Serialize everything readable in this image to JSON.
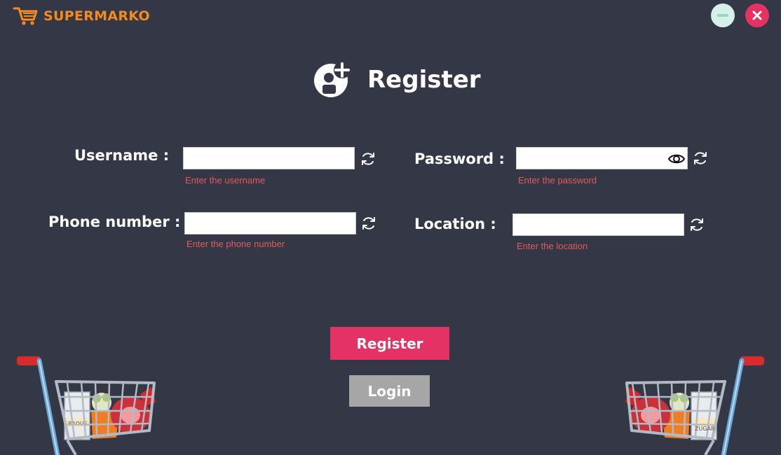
{
  "app": {
    "brand_name": "SUPERMARKO",
    "logo_icon": "shopping-cart-icon"
  },
  "window_controls": {
    "minimize_icon": "minimize-icon",
    "close_icon": "close-icon"
  },
  "colors": {
    "background": "#343745",
    "brand": "#f58a1f",
    "accent": "#e43264",
    "hint": "#e55a5a",
    "login_button": "#a6a6a6",
    "minimize_button": "#d6f0ea"
  },
  "header": {
    "title": "Register",
    "icon": "add-user-icon"
  },
  "form": {
    "username": {
      "label": "Username :",
      "value": "",
      "hint": "Enter the username"
    },
    "password": {
      "label": "Password :",
      "value": "",
      "hint": "Enter the password"
    },
    "phone": {
      "label": "Phone number :",
      "value": "",
      "hint": "Enter the phone number"
    },
    "location": {
      "label": "Location :",
      "value": "",
      "hint": "Enter the location"
    }
  },
  "buttons": {
    "register": "Register",
    "login": "Login"
  },
  "decor": {
    "left_cart": {
      "labels": [
        "RADUS"
      ]
    },
    "right_cart": {
      "labels": [
        "ZUGAR"
      ]
    }
  }
}
